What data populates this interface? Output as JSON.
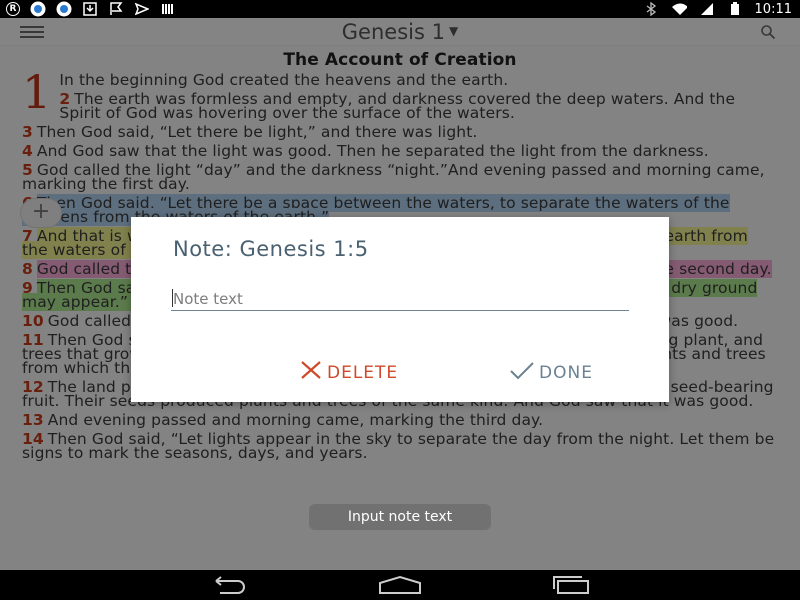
{
  "status_bar": {
    "time": "10:11",
    "r_label": "R"
  },
  "toolbar": {
    "book_title": "Genesis 1",
    "caret": "▼"
  },
  "reader": {
    "heading": "The Account of Creation",
    "drop_cap": "1",
    "verses": [
      {
        "num": "",
        "text": "In the beginning God created the heavens and the earth.",
        "highlight": ""
      },
      {
        "num": "2",
        "text": "The earth was formless and empty, and darkness covered the deep waters. And the Spirit of God was hovering over the surface of the waters.",
        "highlight": ""
      },
      {
        "num": "3",
        "text": "Then God said, “Let there be light,” and there was light.",
        "highlight": ""
      },
      {
        "num": "4",
        "text": "And God saw that the light was good. Then he separated the light from the darkness.",
        "highlight": ""
      },
      {
        "num": "5",
        "text": "God called the light “day” and the darkness “night.”And evening passed and morning came, marking the first day.",
        "highlight": ""
      },
      {
        "num": "6",
        "text": "Then God said, “Let there be a space between the waters, to separate the waters of the heavens from the waters of the earth.”",
        "highlight": "blue"
      },
      {
        "num": "7",
        "text": "And that is what happened. God made this space to separate the waters of the earth from the waters of the heavens.",
        "highlight": "yellow"
      },
      {
        "num": "8",
        "text": "God called the space “sky.” And evening passed and morning came, marking the second day.",
        "highlight": "pink"
      },
      {
        "num": "9",
        "text": "Then God said, “Let the waters beneath the sky flow together into one place, so dry ground may appear.” And that is what happened.",
        "highlight": "green"
      },
      {
        "num": "10",
        "text": "God called the dry ground “land” and the waters “seas.” And God saw that it was good.",
        "highlight": ""
      },
      {
        "num": "11",
        "text": "Then God said, “Let the land sprout with vegetation—every sort of seed-bearing plant, and trees that grow seed-bearing fruit. These seeds will then produce the kinds of plants and trees from which they came.” And that is what happened.",
        "highlight": ""
      },
      {
        "num": "12",
        "text": "The land produced vegetation—all sorts of seed-bearing plants, and trees with seed-bearing fruit. Their seeds produced plants and trees of the same kind. And God saw that it was good.",
        "highlight": ""
      },
      {
        "num": "13",
        "text": "And evening passed and morning came, marking the third day.",
        "highlight": ""
      },
      {
        "num": "14",
        "text": "Then God said, “Let lights appear in the sky to separate the day from the night. Let them be signs to mark the seasons, days, and years.",
        "highlight": ""
      }
    ]
  },
  "add_button": {
    "label": "+"
  },
  "dialog": {
    "title": "Note: Genesis 1:5",
    "input_placeholder": "Note text",
    "input_value": "",
    "delete_label": "DELETE",
    "done_label": "DONE"
  },
  "toast": {
    "text": "Input note text"
  },
  "colors": {
    "verse_number": "#c0391b",
    "highlight_blue": "#a9c8e6",
    "highlight_yellow": "#ecec8c",
    "highlight_pink": "#f0a6cf",
    "highlight_green": "#a8e08a",
    "delete_color": "#cf4a2a",
    "done_color": "#6a8292"
  }
}
